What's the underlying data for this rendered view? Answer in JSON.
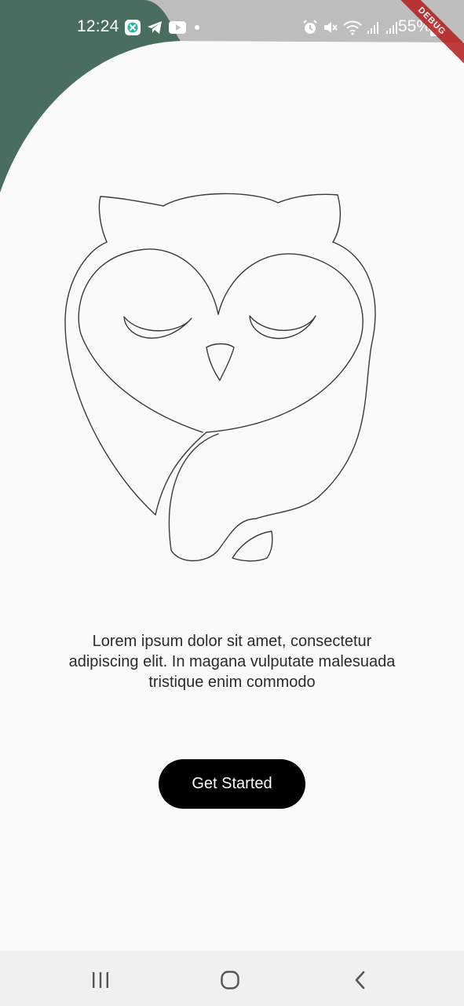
{
  "status_bar": {
    "time": "12:24",
    "battery": "55%",
    "notification_icons": [
      "messaging-app-icon",
      "telegram-icon",
      "youtube-icon",
      "dot-icon"
    ],
    "system_icons": [
      "alarm-icon",
      "mute-icon",
      "wifi-icon",
      "signal-icon",
      "signal-icon-2",
      "battery-icon"
    ]
  },
  "debug_banner": "DEBUG",
  "onboarding": {
    "illustration": "sleeping-owl-illustration",
    "description_lines": [
      "Lorem ipsum dolor sit amet, consectetur",
      "adipiscing elit. In magana vulputate malesuada",
      "tristique enim commodo"
    ],
    "cta_label": "Get Started"
  },
  "nav_bar": {
    "buttons": [
      "recent-apps-icon",
      "home-icon",
      "back-icon"
    ]
  },
  "colors": {
    "accent_green": "#4a6e5e",
    "status_bar": "#bdbdbd",
    "background": "#fafafa",
    "button": "#000000"
  }
}
